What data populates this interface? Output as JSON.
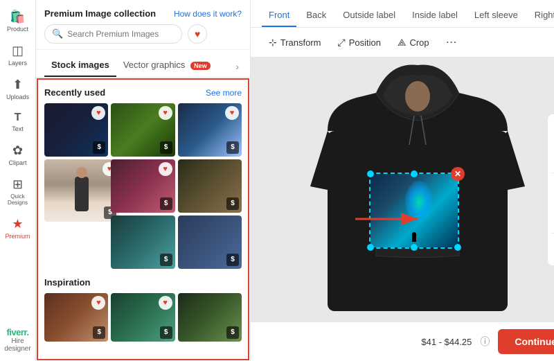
{
  "sidebar": {
    "items": [
      {
        "label": "Product",
        "icon": "🛍️",
        "active": false
      },
      {
        "label": "Layers",
        "icon": "⬡",
        "active": false
      },
      {
        "label": "Uploads",
        "icon": "⬆",
        "active": false
      },
      {
        "label": "Text",
        "icon": "T",
        "active": false
      },
      {
        "label": "Clipart",
        "icon": "✿",
        "active": false
      },
      {
        "label": "Quick\nDesigns",
        "icon": "⊞",
        "active": false
      },
      {
        "label": "Premium",
        "icon": "★",
        "active": true
      }
    ],
    "fiverr": {
      "brand": "fiverr.",
      "hire": "Hire\ndesigner"
    }
  },
  "panel": {
    "title": "Premium Image collection",
    "how_link": "How does it work?",
    "search_placeholder": "Search Premium Images",
    "tabs": [
      {
        "label": "Stock images",
        "active": true
      },
      {
        "label": "Vector graphics",
        "badge": "New",
        "active": false
      }
    ],
    "recently_used_label": "Recently used",
    "see_more_label": "See more",
    "inspiration_label": "Inspiration"
  },
  "toolbar": {
    "tabs": [
      {
        "label": "Front",
        "active": true
      },
      {
        "label": "Back",
        "active": false
      },
      {
        "label": "Outside label",
        "active": false
      },
      {
        "label": "Inside label",
        "active": false
      },
      {
        "label": "Left sleeve",
        "active": false
      },
      {
        "label": "Right !",
        "active": false
      }
    ],
    "tools": [
      {
        "label": "Transform",
        "icon": "⊹"
      },
      {
        "label": "Position",
        "icon": "⤢"
      },
      {
        "label": "Crop",
        "icon": "⟁"
      }
    ],
    "more_icon": "⋯"
  },
  "footer": {
    "price": "$41 - $44.25",
    "info_icon": "ⓘ",
    "continue_label": "Continue"
  },
  "right_tools": [
    {
      "icon": "⊞",
      "label": "grid-icon"
    },
    {
      "icon": "⤢",
      "label": "expand-icon"
    },
    {
      "icon": "⋯",
      "label": "dots-icon"
    },
    {
      "icon": "🔍",
      "label": "zoom-icon"
    },
    {
      "icon": "◯",
      "label": "circle-icon"
    }
  ]
}
